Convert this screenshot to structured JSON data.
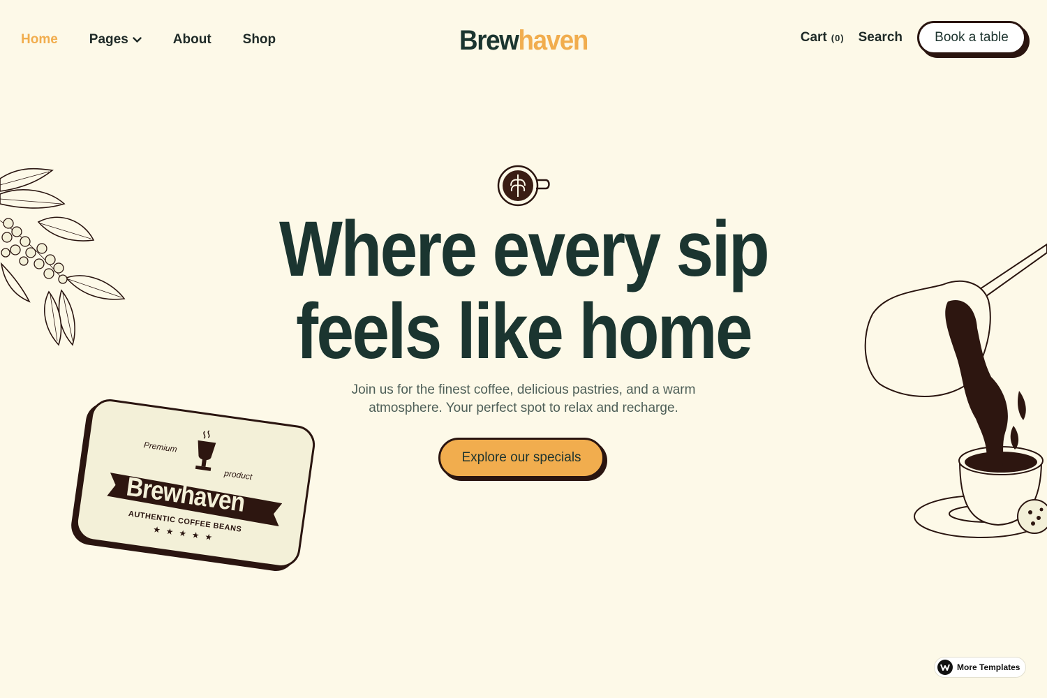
{
  "nav": {
    "home": "Home",
    "pages": "Pages",
    "about": "About",
    "shop": "Shop"
  },
  "brand": {
    "part1": "Brew",
    "part2": "haven"
  },
  "actions": {
    "cart_label": "Cart",
    "cart_count": "(0)",
    "search_label": "Search",
    "book_label": "Book a table"
  },
  "hero": {
    "line1": "Where every sip",
    "line2": "feels like home",
    "subtext": "Join us for the finest coffee, delicious pastries, and a warm atmosphere. Your perfect spot to relax and recharge.",
    "cta": "Explore our specials"
  },
  "badge": {
    "premium": "Premium",
    "product": "product",
    "name": "Brewhaven",
    "tagline": "AUTHENTIC COFFEE BEANS",
    "stars": "★★★★★"
  },
  "footer_chip": {
    "label": "More Templates"
  },
  "colors": {
    "background": "#fdf9e8",
    "accent": "#f1ad4e",
    "primary": "#1b3530",
    "outline": "#2a1510"
  },
  "icons": [
    "chevron-down-icon",
    "latte-cup-icon",
    "coffee-branch-illustration",
    "coffee-pot-pour-illustration",
    "trophy-cup-icon",
    "webflow-logo-icon"
  ]
}
